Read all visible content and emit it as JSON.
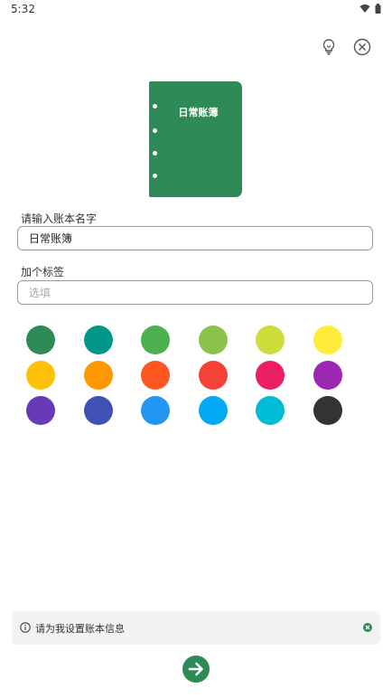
{
  "status_bar": {
    "time": "5:32",
    "icons": [
      "wifi-icon",
      "battery-icon"
    ]
  },
  "header": {
    "icons": [
      "lightbulb-icon",
      "close-circle-icon"
    ]
  },
  "book_preview": {
    "title": "日常账簿",
    "color": "#2e8b57"
  },
  "form": {
    "name_label": "请输入账本名字",
    "name_value": "日常账簿",
    "tag_label": "加个标签",
    "tag_placeholder": "选填"
  },
  "palette": [
    "#2e8b57",
    "#009688",
    "#4caf50",
    "#8bc34a",
    "#cddc39",
    "#ffeb3b",
    "#ffc107",
    "#ff9800",
    "#ff5722",
    "#f44336",
    "#e91e63",
    "#9c27b0",
    "#673ab7",
    "#3f51b5",
    "#2196f3",
    "#03a9f4",
    "#00bcd4",
    "#333333"
  ],
  "tip": {
    "text": "请为我设置账本信息",
    "icon": "info-icon",
    "close_icon": "close-icon"
  },
  "next_button": {
    "icon": "arrow-right-icon",
    "color": "#2e8b57"
  }
}
